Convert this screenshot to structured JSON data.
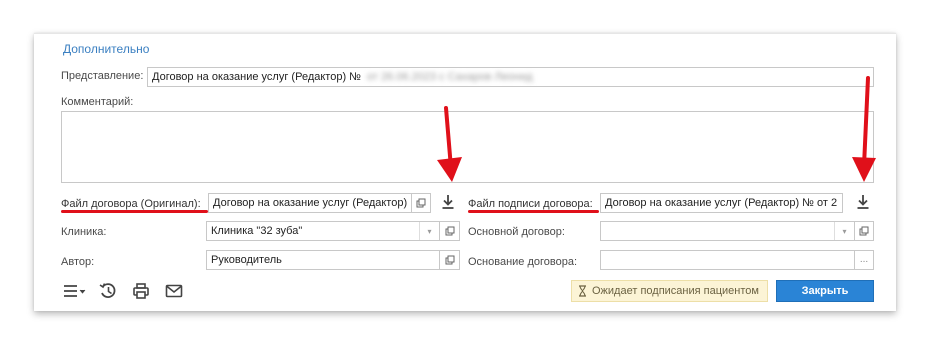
{
  "section": {
    "title": "Дополнительно"
  },
  "representation": {
    "label": "Представление:",
    "value": "Договор на оказание услуг (Редактор) №",
    "hidden_suffix": "от 26.06.2023 с Сахаров Леонид"
  },
  "comment": {
    "label": "Комментарий:",
    "value": ""
  },
  "contract_file": {
    "label": "Файл договора (Оригинал):",
    "value": "Договор на оказание услуг (Редактор)"
  },
  "signature_file": {
    "label": "Файл подписи договора:",
    "value": "Договор на оказание услуг (Редактор) №  от 2"
  },
  "clinic": {
    "label": "Клиника:",
    "value": "Клиника \"32 зуба\""
  },
  "main_contract": {
    "label": "Основной договор:",
    "value": ""
  },
  "author": {
    "label": "Автор:",
    "value": "Руководитель"
  },
  "contract_basis": {
    "label": "Основание договора:",
    "value": "",
    "button": "..."
  },
  "status": {
    "text": "Ожидает подписания пациентом",
    "icon": "hourglass-icon"
  },
  "actions": {
    "close_label": "Закрыть"
  },
  "toolbar_icons": [
    "menu-icon",
    "history-icon",
    "print-icon",
    "mail-icon"
  ],
  "colors": {
    "accent": "#2a84d6",
    "link": "#3a7fc1",
    "annotation": "#e0101a",
    "status_bg": "#fcf4d6"
  }
}
